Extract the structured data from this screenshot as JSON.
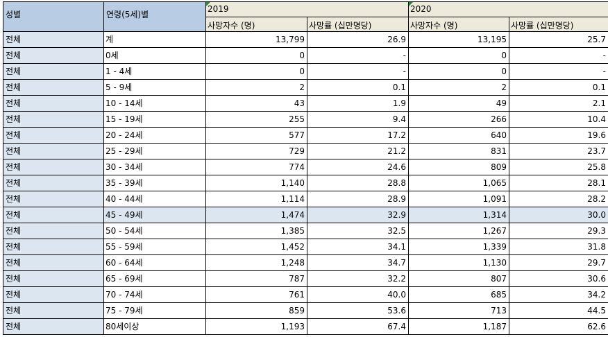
{
  "headers": {
    "sex": "성별",
    "age": "연령(5세)별",
    "year1": "2019",
    "year2": "2020",
    "deaths": "사망자수 (명)",
    "rate": "사망률 (십만명당)"
  },
  "selected_row": 11,
  "rows": [
    {
      "sex": "전체",
      "age": "계",
      "d2019": "13,799",
      "r2019": "26.9",
      "d2020": "13,195",
      "r2020": "25.7"
    },
    {
      "sex": "전체",
      "age": "0세",
      "d2019": "0",
      "r2019": "-",
      "d2020": "0",
      "r2020": "-"
    },
    {
      "sex": "전체",
      "age": "1 - 4세",
      "d2019": "0",
      "r2019": "-",
      "d2020": "0",
      "r2020": "-"
    },
    {
      "sex": "전체",
      "age": "5 - 9세",
      "d2019": "2",
      "r2019": "0.1",
      "d2020": "2",
      "r2020": "0.1"
    },
    {
      "sex": "전체",
      "age": "10 - 14세",
      "d2019": "43",
      "r2019": "1.9",
      "d2020": "49",
      "r2020": "2.1"
    },
    {
      "sex": "전체",
      "age": "15 - 19세",
      "d2019": "255",
      "r2019": "9.4",
      "d2020": "266",
      "r2020": "10.4"
    },
    {
      "sex": "전체",
      "age": "20 - 24세",
      "d2019": "577",
      "r2019": "17.2",
      "d2020": "640",
      "r2020": "19.6"
    },
    {
      "sex": "전체",
      "age": "25 - 29세",
      "d2019": "729",
      "r2019": "21.2",
      "d2020": "831",
      "r2020": "23.7"
    },
    {
      "sex": "전체",
      "age": "30 - 34세",
      "d2019": "774",
      "r2019": "24.6",
      "d2020": "809",
      "r2020": "25.8"
    },
    {
      "sex": "전체",
      "age": "35 - 39세",
      "d2019": "1,140",
      "r2019": "28.8",
      "d2020": "1,065",
      "r2020": "28.1"
    },
    {
      "sex": "전체",
      "age": "40 - 44세",
      "d2019": "1,114",
      "r2019": "28.9",
      "d2020": "1,091",
      "r2020": "28.2"
    },
    {
      "sex": "전체",
      "age": "45 - 49세",
      "d2019": "1,474",
      "r2019": "32.9",
      "d2020": "1,314",
      "r2020": "30.0"
    },
    {
      "sex": "전체",
      "age": "50 - 54세",
      "d2019": "1,385",
      "r2019": "32.5",
      "d2020": "1,267",
      "r2020": "29.3"
    },
    {
      "sex": "전체",
      "age": "55 - 59세",
      "d2019": "1,452",
      "r2019": "34.1",
      "d2020": "1,339",
      "r2020": "31.8"
    },
    {
      "sex": "전체",
      "age": "60 - 64세",
      "d2019": "1,248",
      "r2019": "34.7",
      "d2020": "1,130",
      "r2020": "29.7"
    },
    {
      "sex": "전체",
      "age": "65 - 69세",
      "d2019": "787",
      "r2019": "32.2",
      "d2020": "807",
      "r2020": "30.6"
    },
    {
      "sex": "전체",
      "age": "70 - 74세",
      "d2019": "761",
      "r2019": "40.0",
      "d2020": "685",
      "r2020": "34.2"
    },
    {
      "sex": "전체",
      "age": "75 - 79세",
      "d2019": "859",
      "r2019": "53.6",
      "d2020": "713",
      "r2020": "44.5"
    },
    {
      "sex": "전체",
      "age": "80세이상",
      "d2019": "1,193",
      "r2019": "67.4",
      "d2020": "1,187",
      "r2020": "62.6"
    }
  ]
}
